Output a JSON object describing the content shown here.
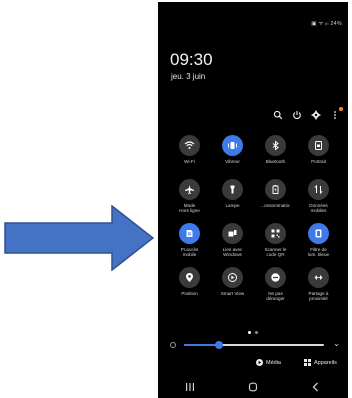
{
  "colors": {
    "arrow_fill": "#4472c4",
    "arrow_stroke": "#2f528f",
    "accent": "#3e7bea",
    "tile_off": "#3a3a3c"
  },
  "status_bar": {
    "text": "▣ ᯤ ᵢₗₗ 24%"
  },
  "clock": {
    "time": "09:30",
    "date": "jeu. 3 juin"
  },
  "top_icons": [
    "search-icon",
    "power-icon",
    "gear-icon",
    "more-vertical-icon"
  ],
  "tiles": [
    {
      "label": "Wi-Fi",
      "icon": "wifi-icon",
      "active": false
    },
    {
      "label": "Vibreur",
      "icon": "vibrate-icon",
      "active": true
    },
    {
      "label": "Bluetooth",
      "icon": "bluetooth-icon",
      "active": false
    },
    {
      "label": "Portrait",
      "icon": "portrait-lock-icon",
      "active": false
    },
    {
      "label": "Mode\nHors ligne",
      "icon": "airplane-icon",
      "active": false
    },
    {
      "label": "Lampe",
      "icon": "flashlight-icon",
      "active": false
    },
    {
      "label": "...onsommatio-",
      "icon": "power-saving-icon",
      "active": false
    },
    {
      "label": "Données\nmobiles",
      "icon": "mobile-data-icon",
      "active": false
    },
    {
      "label": "Pr.accès\nmobile",
      "icon": "hotspot-icon",
      "active": true
    },
    {
      "label": "Lien avec\nWindows",
      "icon": "link-windows-icon",
      "active": false
    },
    {
      "label": "Scanner le\ncode QR",
      "icon": "qr-scan-icon",
      "active": false
    },
    {
      "label": "Filtre de\nlum. bleue",
      "icon": "blue-light-icon",
      "active": true
    },
    {
      "label": "Position",
      "icon": "location-icon",
      "active": false
    },
    {
      "label": "Smart View",
      "icon": "smart-view-icon",
      "active": false
    },
    {
      "label": "Ne pas\ndéranger",
      "icon": "do-not-disturb-icon",
      "active": false
    },
    {
      "label": "Partage à\nproximité",
      "icon": "nearby-share-icon",
      "active": false
    }
  ],
  "brightness": {
    "level": 0.25
  },
  "media_button": {
    "label": "Média"
  },
  "apps_button": {
    "label": "Appareils"
  },
  "pager": {
    "pages": 2,
    "current": 1
  }
}
